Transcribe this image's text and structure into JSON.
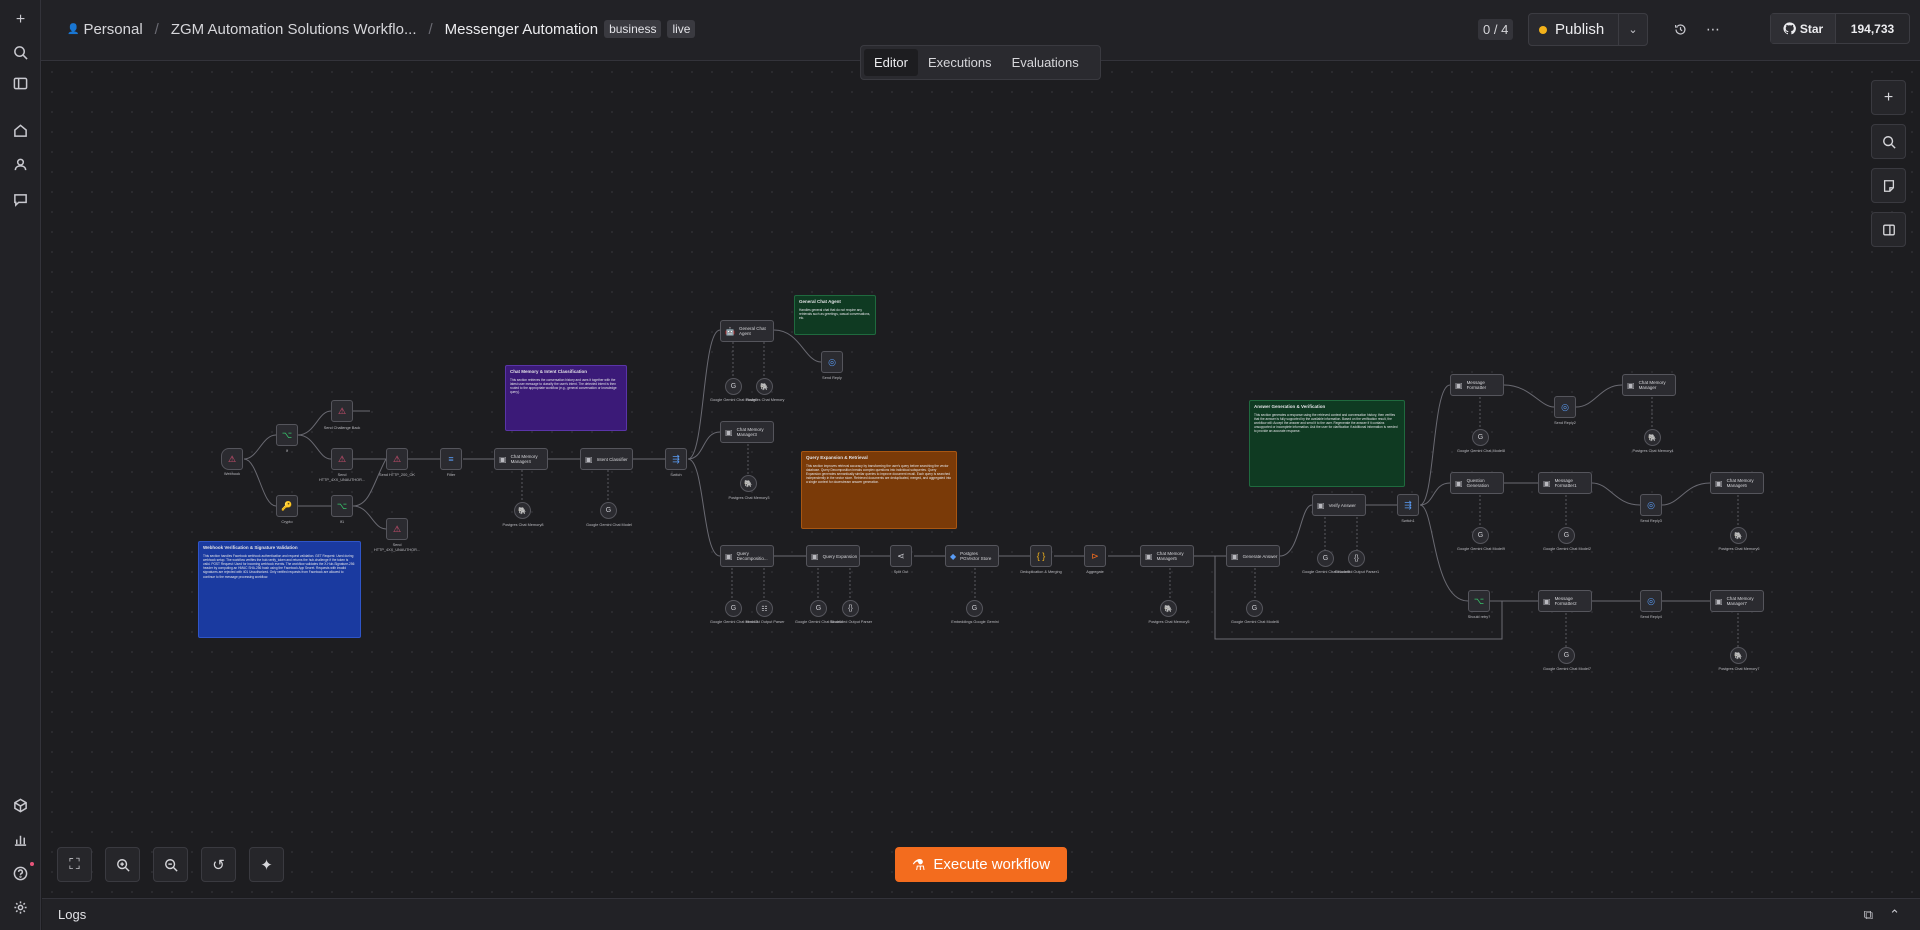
{
  "rail": {
    "items": [
      {
        "name": "add-icon",
        "glyph": "+"
      },
      {
        "name": "search-icon",
        "glyph": "⌕"
      },
      {
        "name": "sidebar-toggle-icon",
        "glyph": "▯"
      },
      {
        "name": "home-icon",
        "glyph": "⌂"
      },
      {
        "name": "user-icon",
        "glyph": "👤"
      },
      {
        "name": "chat-icon",
        "glyph": "💬"
      }
    ],
    "bottom": [
      {
        "name": "templates-icon",
        "glyph": "◈"
      },
      {
        "name": "insights-icon",
        "glyph": "▤"
      },
      {
        "name": "help-icon",
        "glyph": "?"
      },
      {
        "name": "settings-icon",
        "glyph": "⚙"
      }
    ]
  },
  "header": {
    "crumb_personal": "Personal",
    "crumb_project": "ZGM Automation Solutions Workflo...",
    "workflow_name": "Messenger Automation",
    "tags": [
      "business",
      "live"
    ],
    "counter": "0 / 4",
    "publish_label": "Publish",
    "github_star": "Star",
    "github_count": "194,733"
  },
  "tabs": [
    "Editor",
    "Executions",
    "Evaluations"
  ],
  "canvas": {
    "execute_label": "Execute workflow",
    "logs_label": "Logs"
  },
  "stickies": [
    {
      "key": "chat_memory",
      "title": "Chat Memory & Intent Classification",
      "body": "This section retrieves the conversation history and uses it together with the latest user message to classify the user's intent. The detected intent is then routed to the appropriate workflow (e.g., general conversation or knowledge query).",
      "color": "#3b1a78"
    },
    {
      "key": "general_agent",
      "title": "General Chat Agent",
      "body": "Handles general chat that do not require any retrievals such as greetings, casual conversations, etc.",
      "color": "#0f3a22"
    },
    {
      "key": "query_expansion",
      "title": "Query Expansion & Retrieval",
      "body": "This section improves retrieval accuracy by transforming the user's query before searching the vector database. Query Decomposition breaks complex questions into individual subqueries. Query Expansion generates semantically similar queries to improve document recall. Each query is searched independently in the vector store. Retrieved documents are deduplicated, merged, and aggregated into a single context for downstream answer generation.",
      "color": "#7a3a08"
    },
    {
      "key": "answer_gen",
      "title": "Answer Generation & Verification",
      "body": "This section generates a response using the retrieved context and conversation history, then verifies that the answer is fully supported by the available information. Based on the verification result, the workflow will: Accept the answer and send it to the user. Regenerate the answer if it contains unsupported or incomplete information. Ask the user for clarification if additional information is needed to provide an accurate response.",
      "color": "#0f3a22"
    },
    {
      "key": "webhook",
      "title": "Webhook Verification & Signature Validation",
      "body": "This section handles Facebook webhook authentication and request validation. GET Request: Used during webhook setup. The workflow verifies the hub.verify_token and returns the hub.challenge if the token is valid. POST Request: Used for incoming webhook events. The workflow validates the X-Hub-Signature-256 header by computing an HMAC SHA-256 hash using the Facebook App Secret. Requests with invalid signatures are rejected with 401 Unauthorized. Only verified requests from Facebook are allowed to continue to the message processing workflow.",
      "color": "#1a3aa0"
    }
  ],
  "nodes": {
    "webhook": "Webhook",
    "if1": "If",
    "crypto": "Crypto",
    "send_challenge": "Send Challenge Back",
    "send_http": "Send HTTP_4XX_UNAUTHOR...",
    "if2": "If1",
    "send_http2": "Send HTTP_4XX_UNAUTHOR...",
    "send_http_200": "Send HTTP_200_OK",
    "filter": "Filter",
    "chat_mem": "Chat Memory Manager4",
    "intent": "Intent Classifier",
    "switch": "Switch",
    "pg_chat_mem": "Postgres Chat Memory8",
    "gemini1": "Google Gemini Chat Model",
    "general_agent": "General Chat Agent",
    "gemini_gc": "Google Gemini Chat Model1",
    "pg_gc": "Postgres Chat Memory",
    "send_reply": "Send Reply",
    "chat_mem2": "Chat Memory Manager3",
    "pg_mem3": "Postgres Chat Memory3",
    "query_decomp": "Query Decompositio...",
    "gem_q1": "Google Gemini Chat Model3",
    "item_list": "Item List Output Parser",
    "query_exp": "Query Expansion",
    "gem_q2": "Google Gemini Chat Model4",
    "struct_parser": "Structured Output Parser",
    "split_out": "Split Out",
    "pinecone": "Postgres PGVector Store",
    "embeddings": "Embeddings Google Gemini",
    "dedup": "Deduplication & Merging",
    "aggregate": "Aggregate",
    "chat_mem5": "Chat Memory Manager5",
    "pg_mem5": "Postgres Chat Memory5",
    "gen_answer": "Generate Answer",
    "gem_gen": "Google Gemini Chat Model6",
    "verify": "Verify Answer",
    "gem_verify": "Google Gemini Chat Model5",
    "struct_parser2": "Structured Output Parser1",
    "switch2": "Switch1",
    "msg_formatter": "Message Formatter",
    "gem_msg": "Google Gemini Chat Model8",
    "send_reply2": "Send Reply2",
    "chat_mem_m": "Chat Memory Manager",
    "pg_mem_m": "Postgres Chat Memory4",
    "question_reg": "Question Generation",
    "gem_qr": "Google Gemini Chat Model9",
    "msg_formatter2": "Message Formatter1",
    "gem_mf2": "Google Gemini Chat Model2",
    "send_reply3": "Send Reply3",
    "chat_mem_m2": "Chat Memory Manager6",
    "pg_mem_m2": "Postgres Chat Memory6",
    "should_retry": "Should retry?",
    "msg_formatter3": "Message Formatter2",
    "gem_mf3": "Google Gemini Chat Model7",
    "send_reply4": "Send Reply4",
    "chat_mem_m3": "Chat Memory Manager7",
    "pg_mem_m3": "Postgres Chat Memory7"
  }
}
